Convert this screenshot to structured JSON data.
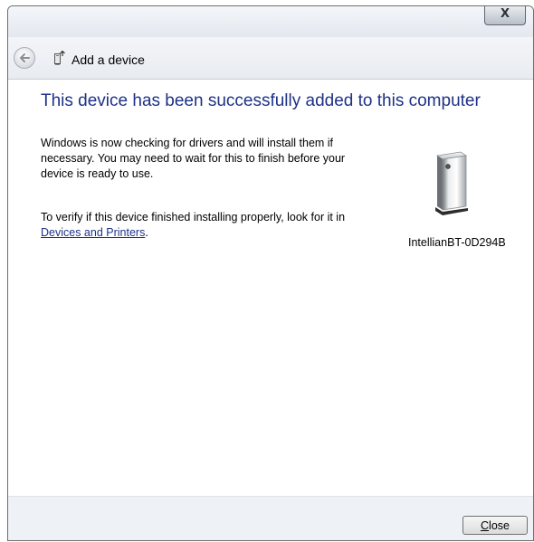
{
  "titlebar": {
    "close_label": "X"
  },
  "header": {
    "title": "Add a device"
  },
  "main": {
    "heading": "This device has been successfully added to this computer",
    "paragraph1": "Windows is now checking for drivers and will install them if necessary. You may need to wait for this to finish before your device is ready to use.",
    "paragraph2_text": "To verify if this device finished installing properly, look for it in",
    "paragraph2_link": "Devices and Printers",
    "paragraph2_end": "."
  },
  "device": {
    "name": "IntellianBT-0D294B",
    "icon": "device-tower-icon"
  },
  "footer": {
    "close_access_key": "C",
    "close_rest": "lose"
  },
  "icons": {
    "back": "back-arrow-icon",
    "wizard": "add-device-icon"
  },
  "colors": {
    "heading": "#1e3287",
    "link": "#1e3287"
  }
}
